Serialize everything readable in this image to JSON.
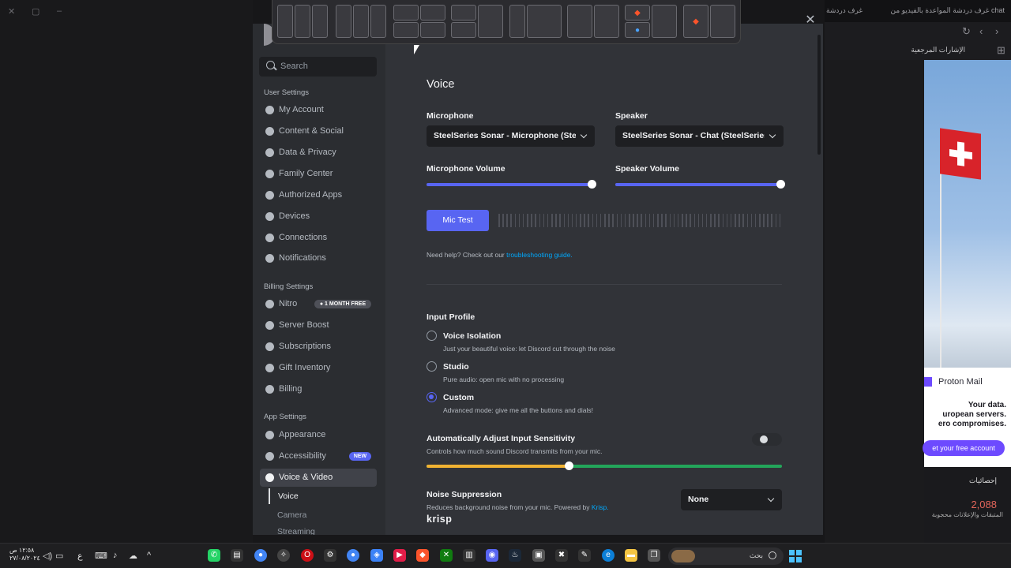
{
  "window_controls": {
    "close": "✕",
    "restore": "▢",
    "minimize": "–"
  },
  "browser": {
    "tabs": [
      "غرف دردشة المواعدة بالفيديو من chat",
      "غرف دردشة"
    ],
    "bookmark": "الإشارات المرجعية",
    "proton": {
      "brand": "Proton Mail",
      "line1": "Your data.",
      "line2": "uropean servers.",
      "line3": "ero compromises.",
      "cta": "et your free account"
    },
    "stats": {
      "heading": "إحصائيات",
      "number": "2,088",
      "sub": "المتبقات والإعلانات محجوبة"
    }
  },
  "discord": {
    "close_icon": "✕",
    "search_placeholder": "Search",
    "sections": {
      "user": "User Settings",
      "billing": "Billing Settings",
      "app": "App Settings"
    },
    "nav_user": [
      {
        "label": "My Account",
        "icon": "user-icon"
      },
      {
        "label": "Content & Social",
        "icon": "content-icon"
      },
      {
        "label": "Data & Privacy",
        "icon": "shield-icon"
      },
      {
        "label": "Family Center",
        "icon": "family-icon"
      },
      {
        "label": "Authorized Apps",
        "icon": "apps-icon"
      },
      {
        "label": "Devices",
        "icon": "devices-icon"
      },
      {
        "label": "Connections",
        "icon": "link-icon"
      },
      {
        "label": "Notifications",
        "icon": "bell-icon"
      }
    ],
    "nav_billing": [
      {
        "label": "Nitro",
        "icon": "nitro-icon",
        "badge": "1 MONTH FREE"
      },
      {
        "label": "Server Boost",
        "icon": "boost-icon"
      },
      {
        "label": "Subscriptions",
        "icon": "subscriptions-icon"
      },
      {
        "label": "Gift Inventory",
        "icon": "gift-icon"
      },
      {
        "label": "Billing",
        "icon": "card-icon"
      }
    ],
    "nav_app": [
      {
        "label": "Appearance",
        "icon": "palette-icon"
      },
      {
        "label": "Accessibility",
        "icon": "accessibility-icon",
        "badge": "NEW"
      },
      {
        "label": "Voice & Video",
        "icon": "microphone-icon"
      }
    ],
    "voice_sub": [
      "Voice",
      "Camera",
      "Streaming"
    ],
    "main": {
      "title": "Voice",
      "microphone_label": "Microphone",
      "microphone_value": "SteelSeries Sonar - Microphone (Stee",
      "speaker_label": "Speaker",
      "speaker_value": "SteelSeries Sonar - Chat (SteelSeries",
      "mic_volume_label": "Microphone Volume",
      "mic_volume": 1.0,
      "speaker_volume_label": "Speaker Volume",
      "speaker_volume": 1.0,
      "mic_test_button": "Mic Test",
      "help_text": "Need help? Check out our",
      "help_link": "troubleshooting guide.",
      "input_profile_label": "Input Profile",
      "profiles": [
        {
          "name": "Voice Isolation",
          "desc": "Just your beautiful voice: let Discord cut through the noise",
          "selected": false
        },
        {
          "name": "Studio",
          "desc": "Pure audio: open mic with no processing",
          "selected": false
        },
        {
          "name": "Custom",
          "desc": "Advanced mode: give me all the buttons and dials!",
          "selected": true
        }
      ],
      "auto_sensitivity_label": "Automatically Adjust Input Sensitivity",
      "auto_sensitivity_desc": "Controls how much sound Discord transmits from your mic.",
      "auto_sensitivity_on": false,
      "sensitivity_level": 0.4,
      "noise_suppression_label": "Noise Suppression",
      "noise_suppression_desc": "Reduces background noise from your mic. Powered by",
      "noise_suppression_link": "Krisp.",
      "noise_suppression_value": "None",
      "krisp_logo": "krisp"
    },
    "colors": {
      "accent": "#5865f2",
      "slider_yellow": "#f0b232",
      "slider_green": "#23a55a"
    }
  },
  "taskbar": {
    "time": "١٢:٥٨ ص",
    "date": "٢٧/٠٨/٢٠٢٤",
    "lang": "ع",
    "search_placeholder": "بحث"
  }
}
